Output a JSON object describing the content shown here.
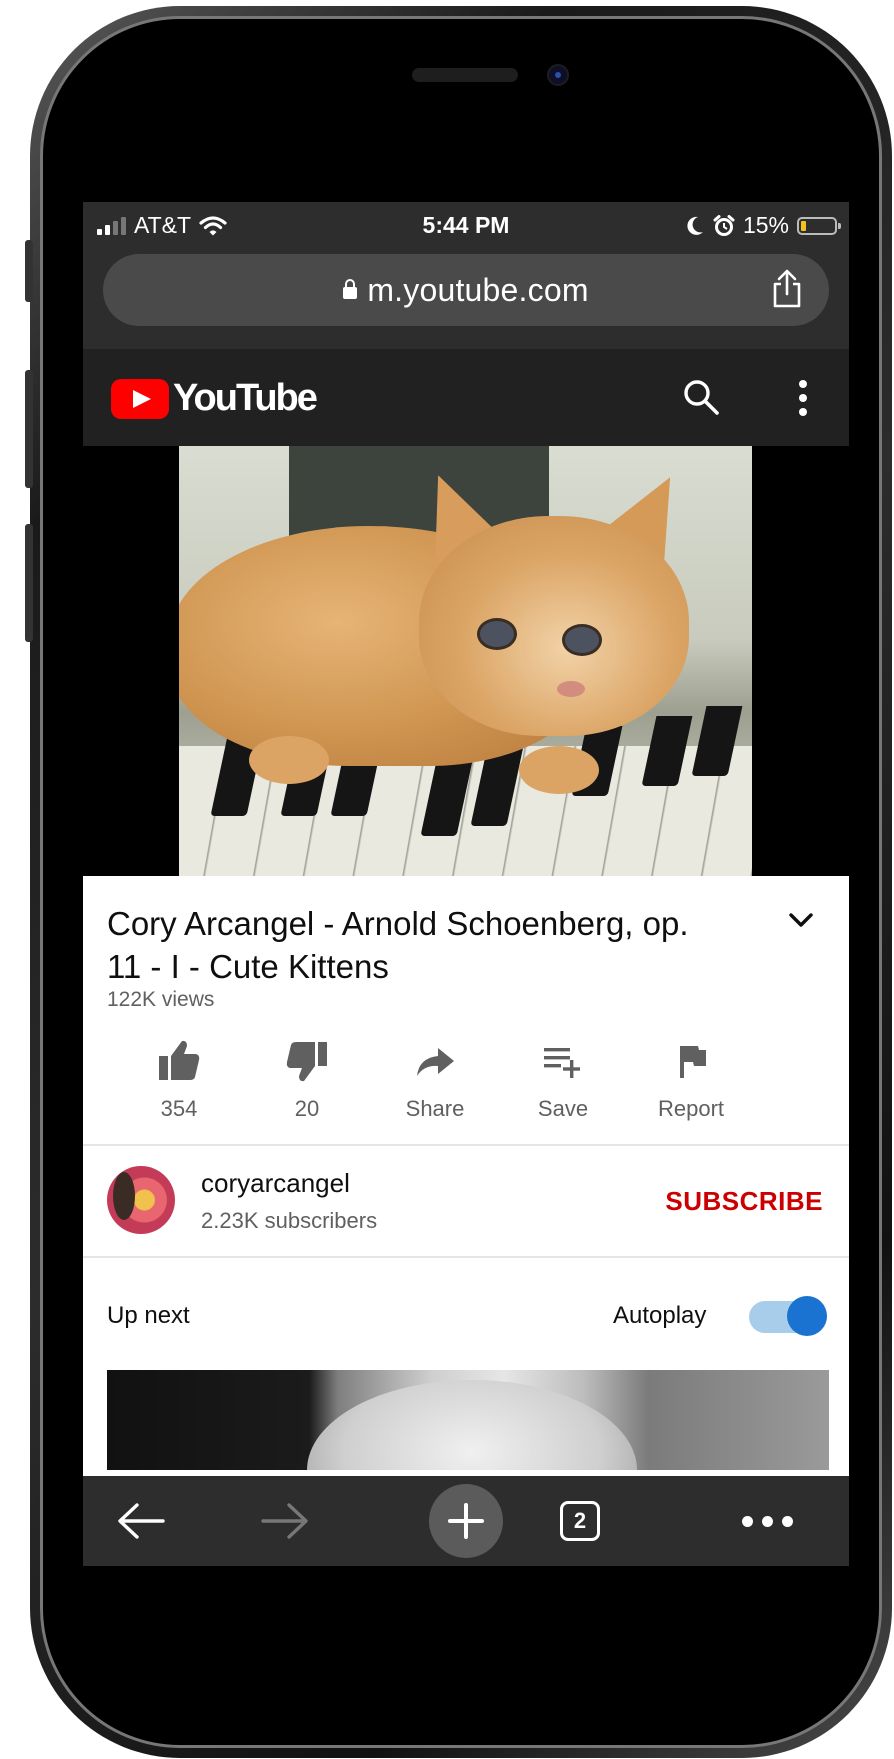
{
  "status_bar": {
    "carrier": "AT&T",
    "time": "5:44 PM",
    "battery_percent": "15%",
    "battery_level": 0.15,
    "icons": [
      "signal-icon",
      "wifi-icon",
      "moon-icon",
      "alarm-icon",
      "battery-icon"
    ]
  },
  "browser": {
    "url": "m.youtube.com",
    "icons": [
      "lock-icon",
      "share-icon"
    ]
  },
  "youtube_header": {
    "logo_text": "YouTube",
    "icons": [
      "youtube-play-icon",
      "search-icon",
      "more-vert-icon"
    ]
  },
  "video": {
    "title": "Cory Arcangel - Arnold Schoenberg, op. 11 - I - Cute Kittens",
    "views": "122K views",
    "actions": [
      {
        "label": "354",
        "icon": "thumbs-up-icon"
      },
      {
        "label": "20",
        "icon": "thumbs-down-icon"
      },
      {
        "label": "Share",
        "icon": "share-arrow-icon"
      },
      {
        "label": "Save",
        "icon": "playlist-add-icon"
      },
      {
        "label": "Report",
        "icon": "flag-icon"
      }
    ]
  },
  "channel": {
    "name": "coryarcangel",
    "subscribers": "2.23K subscribers",
    "subscribe_label": "SUBSCRIBE"
  },
  "up_next": {
    "label": "Up next",
    "autoplay_label": "Autoplay",
    "autoplay_on": true
  },
  "toolbar": {
    "tab_count": "2",
    "icons": [
      "back-arrow-icon",
      "forward-arrow-icon",
      "new-tab-plus-icon",
      "tabs-icon",
      "more-horiz-icon"
    ]
  },
  "colors": {
    "youtube_red": "#ff0000",
    "subscribe_red": "#cc0000",
    "toggle_blue": "#1a73d0",
    "browser_chrome": "#2d2d2d"
  }
}
